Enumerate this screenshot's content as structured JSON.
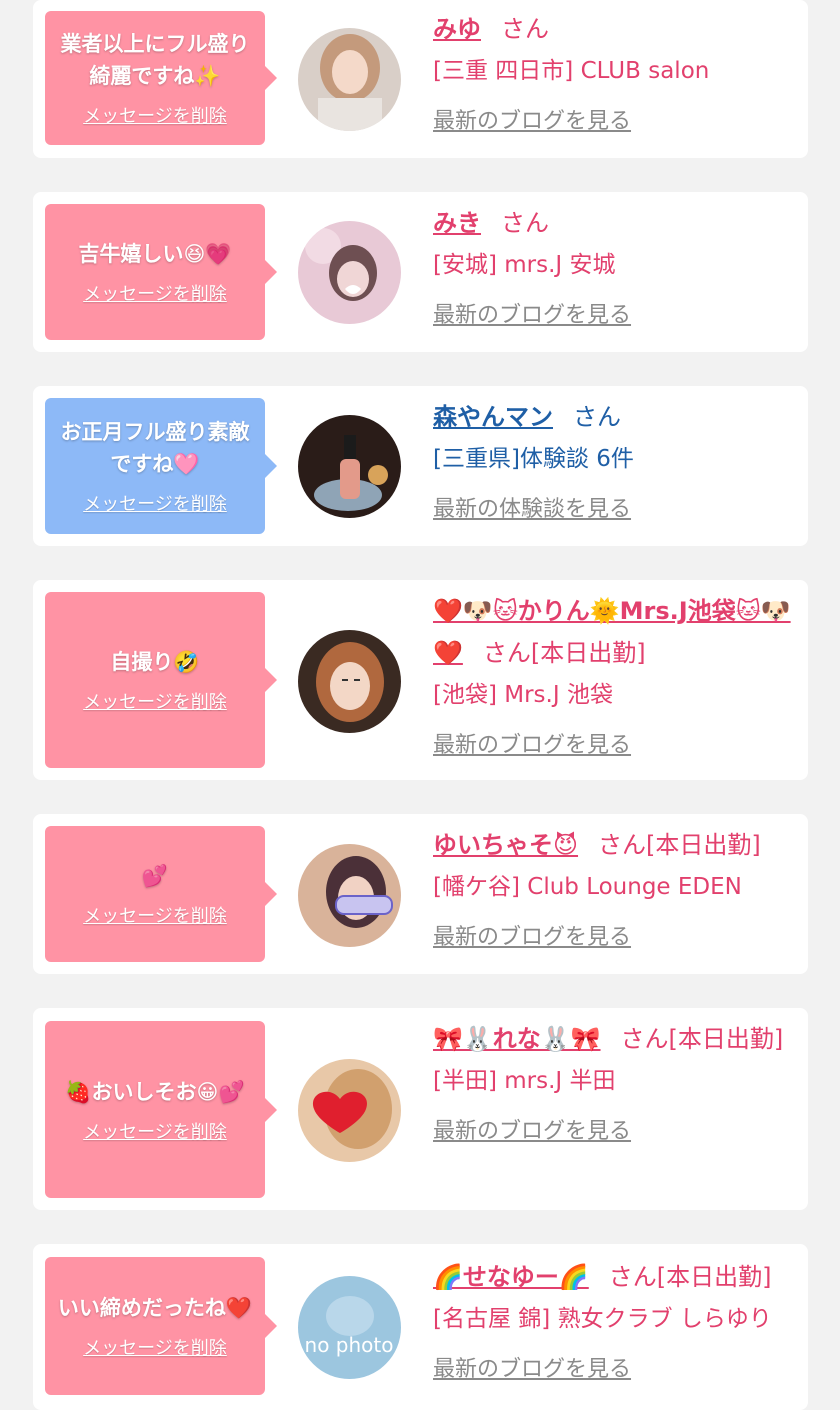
{
  "common": {
    "delete_label": "メッセージを削除",
    "san": "さん",
    "blog_link": "最新のブログを見る",
    "review_link": "最新の体験談を見る"
  },
  "items": [
    {
      "message": "業者以上にフル盛り綺麗ですね✨",
      "name": "みゆ",
      "san": "さん",
      "shop": "[三重 四日市] CLUB salon",
      "link": "最新のブログを見る",
      "bubble_color": "#ff93a4"
    },
    {
      "message": "吉牛嬉しい😆💗",
      "name": "みき",
      "san": "さん",
      "shop": "[安城] mrs.J 安城",
      "link": "最新のブログを見る",
      "bubble_color": "#ff93a4"
    },
    {
      "message": "お正月フル盛り素敵ですね🩷",
      "name": "森やんマン",
      "san": "さん",
      "shop": "[三重県]体験談 6件",
      "link": "最新の体験談を見る",
      "bubble_color": "#8db9f7"
    },
    {
      "message": "自撮り🤣",
      "name": "❤️🐶🐱かりん🌞Mrs.J池袋🐱🐶❤️",
      "san": "さん[本日出勤]",
      "shop": "[池袋] Mrs.J 池袋",
      "link": "最新のブログを見る",
      "bubble_color": "#ff93a4"
    },
    {
      "message": "💕",
      "name": "ゆいちゃそ😈",
      "san": "さん[本日出勤]",
      "shop": "[幡ケ谷] Club Lounge EDEN",
      "link": "最新のブログを見る",
      "bubble_color": "#ff93a4"
    },
    {
      "message": "🍓おいしそお😀💕",
      "name": "🎀🐰れな🐰🎀",
      "san": "さん[本日出勤]",
      "shop": "[半田] mrs.J 半田",
      "link": "最新のブログを見る",
      "bubble_color": "#ff93a4"
    },
    {
      "message": "いい締めだったね❤️",
      "name": "🌈せなゆー🌈",
      "san": "さん[本日出勤]",
      "shop": "[名古屋 錦] 熟女クラブ しらゆり",
      "link": "最新のブログを見る",
      "bubble_color": "#ff93a4"
    }
  ],
  "avatars": [
    "woman-photo",
    "woman-photo-filter",
    "champagne-bottle-photo",
    "woman-selfie",
    "woman-love-sticker",
    "heart-cover-photo",
    "no-photo"
  ],
  "no_photo_text": "no photo"
}
